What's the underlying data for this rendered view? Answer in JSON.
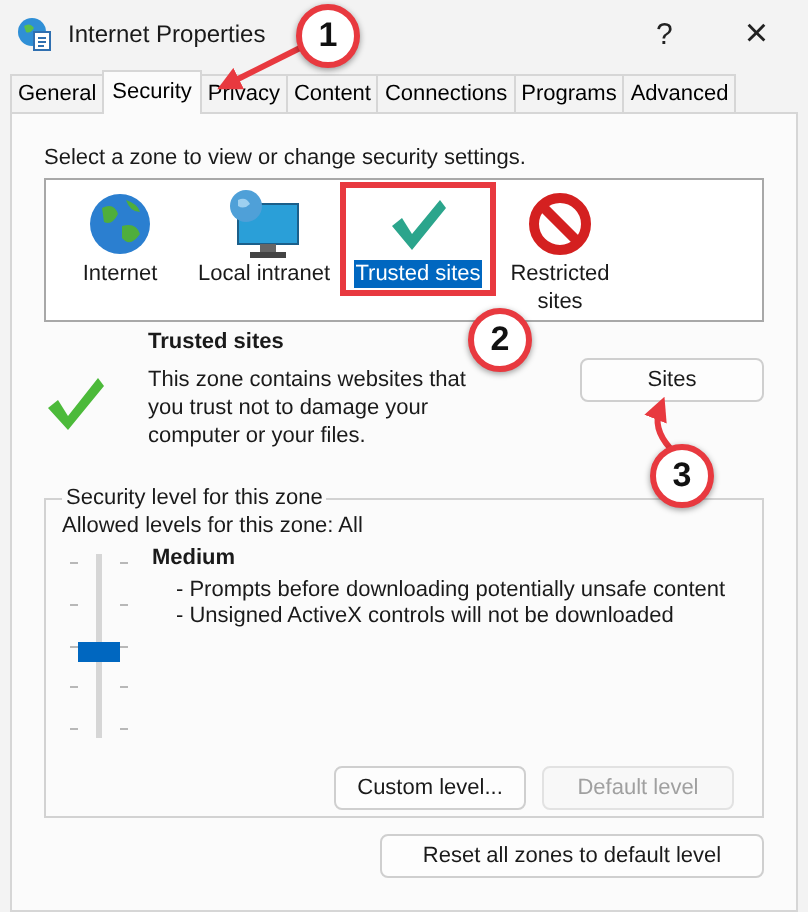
{
  "window": {
    "title": "Internet Properties",
    "help": "?",
    "close": "×"
  },
  "tabs": [
    {
      "label": "General",
      "selected": false
    },
    {
      "label": "Security",
      "selected": true
    },
    {
      "label": "Privacy",
      "selected": false
    },
    {
      "label": "Content",
      "selected": false
    },
    {
      "label": "Connections",
      "selected": false
    },
    {
      "label": "Programs",
      "selected": false
    },
    {
      "label": "Advanced",
      "selected": false
    }
  ],
  "zones": {
    "prompt": "Select a zone to view or change security settings.",
    "items": [
      {
        "label": "Internet",
        "kind": "globe",
        "selected": false
      },
      {
        "label": "Local intranet",
        "kind": "intranet",
        "selected": false
      },
      {
        "label": "Trusted sites",
        "kind": "trusted",
        "selected": true
      },
      {
        "label": "Restricted sites",
        "kind": "restricted",
        "selected": false
      }
    ]
  },
  "zone_info": {
    "title": "Trusted sites",
    "description": "This zone contains websites that you trust not to damage your computer or your files.",
    "button": "Sites"
  },
  "security_level": {
    "legend": "Security level for this zone",
    "allowed": "Allowed levels for this zone: All",
    "slider": {
      "level": 0.5
    },
    "name": "Medium",
    "bullets": [
      "- Prompts before downloading potentially unsafe content",
      "- Unsigned ActiveX controls will not be downloaded"
    ],
    "buttons": [
      {
        "label": "Custom level...",
        "disabled": false
      },
      {
        "label": "Default level",
        "disabled": true
      }
    ]
  },
  "reset_button": "Reset all zones to default level",
  "annotations": [
    {
      "number": "1"
    },
    {
      "number": "2"
    },
    {
      "number": "3"
    }
  ]
}
